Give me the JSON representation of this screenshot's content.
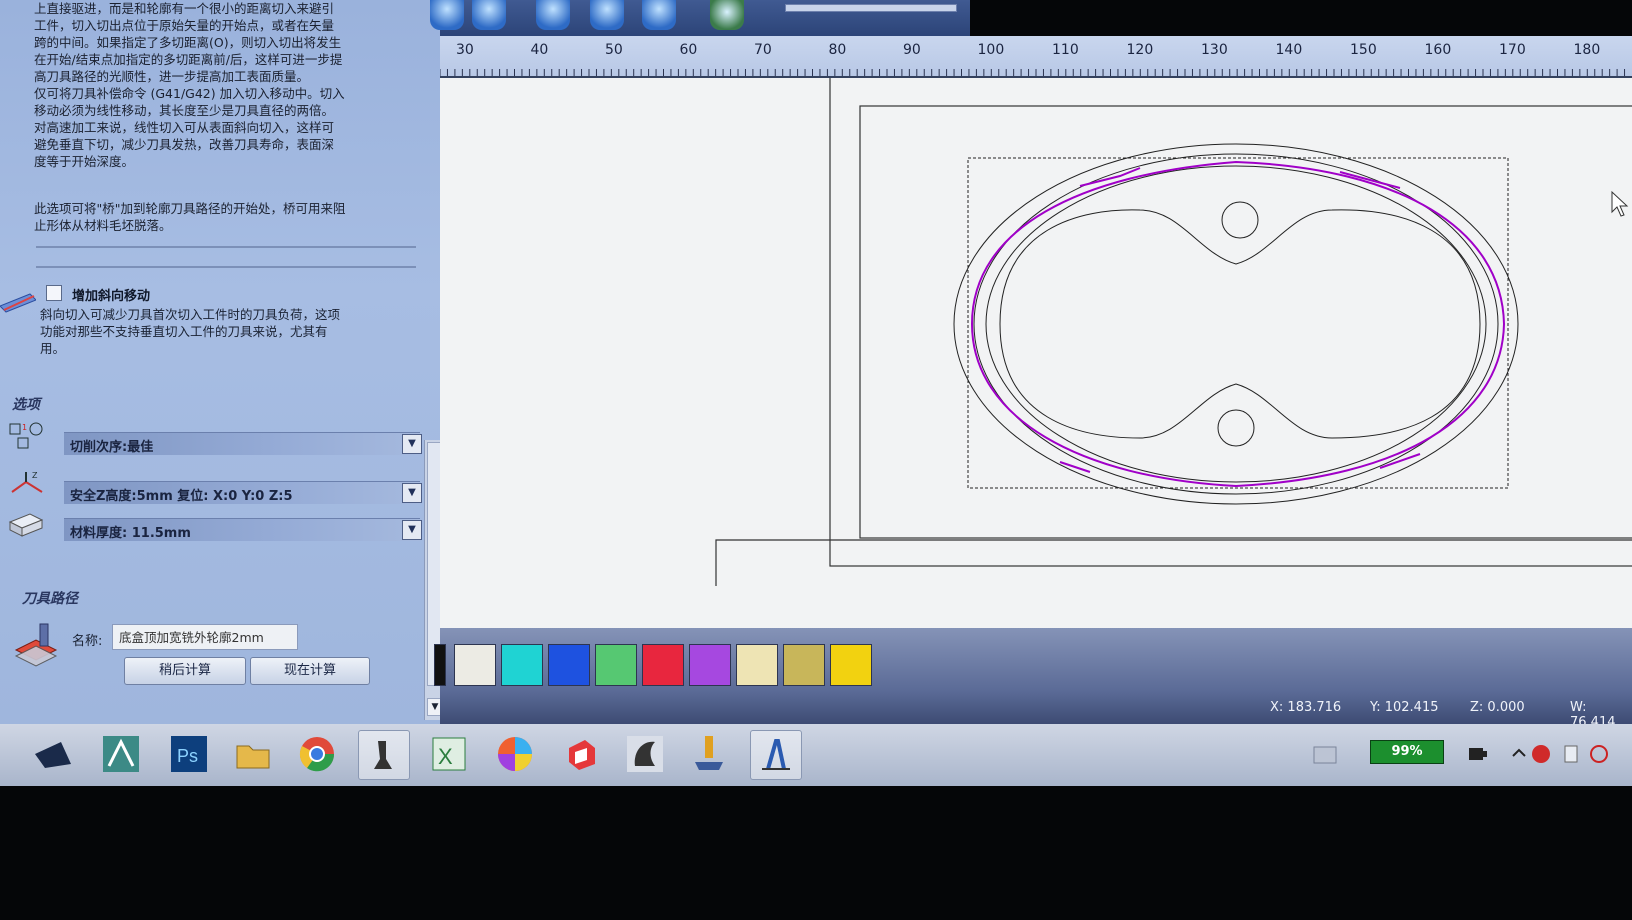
{
  "left_panel": {
    "intro_text": "上直接驱进，而是和轮廓有一个很小的距离切入来避引\n工件，切入切出点位于原始矢量的开始点，或者在矢量\n跨的中间。如果指定了多切距离(O)，则切入切出将发生\n在开始/结束点加指定的多切距离前/后，这样可进一步提\n高刀具路径的光顺性，进一步提高加工表面质量。\n仅可将刀具补偿命令 (G41/G42) 加入切入移动中。切入\n移动必须为线性移动，其长度至少是刀具直径的两倍。\n对高速加工来说，线性切入可从表面斜向切入，这样可\n避免垂直下切，减少刀具发热，改善刀具寿命，表面深\n度等于开始深度。",
    "bridge_text": "此选项可将\"桥\"加到轮廓刀具路径的开始处，桥可用来阻\n止形体从材料毛坯脱落。",
    "ramp": {
      "title": "增加斜向移动",
      "description": "斜向切入可减少刀具首次切入工件时的刀具负荷，这项\n功能对那些不支持垂直切入工件的刀具来说，尤其有\n用。"
    },
    "options": {
      "title": "选项",
      "cut_order": "切削次序:最佳",
      "safe_z": "安全Z高度:5mm 复位: X:0 Y:0 Z:5",
      "material_thickness": "材料厚度: 11.5mm"
    },
    "toolpath": {
      "title": "刀具路径",
      "name_label": "名称:",
      "name_value": "底盒顶加宽铣外轮廓2mm",
      "calc_later": "稍后计算",
      "calc_now": "现在计算"
    }
  },
  "ruler": {
    "ticks": [
      "30",
      "40",
      "50",
      "60",
      "70",
      "80",
      "90",
      "100",
      "110",
      "120",
      "130",
      "140",
      "150",
      "160",
      "170",
      "180"
    ]
  },
  "palette": {
    "colors": [
      "#111111",
      "#ecebe4",
      "#1fd3d3",
      "#1e52e0",
      "#56c872",
      "#e8263e",
      "#a648e0",
      "#eee4b4",
      "#c8b65a",
      "#f2d210"
    ]
  },
  "status": {
    "x": "X: 183.716",
    "y": "Y: 102.415",
    "z": "Z: 0.000",
    "w": "W: 76.414"
  },
  "taskbar": {
    "battery": "99%"
  }
}
